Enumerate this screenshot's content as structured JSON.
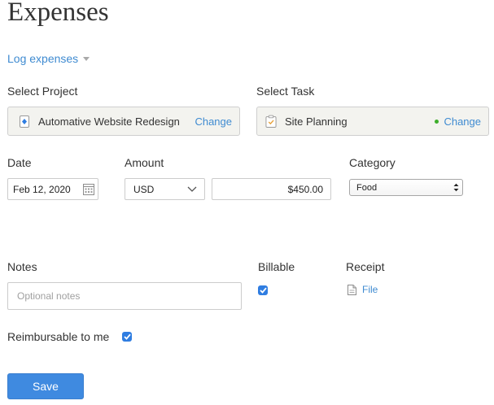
{
  "page": {
    "title": "Expenses"
  },
  "log_menu": {
    "label": "Log expenses"
  },
  "project": {
    "label": "Select Project",
    "selected": "Automative Website Redesign",
    "change_label": "Change"
  },
  "task": {
    "label": "Select Task",
    "selected": "Site Planning",
    "change_label": "Change",
    "status_color": "#3dae2b"
  },
  "date": {
    "label": "Date",
    "value": "Feb 12, 2020",
    "icon": "calendar-icon"
  },
  "amount": {
    "label": "Amount",
    "currency": "USD",
    "value": "$450.00"
  },
  "category": {
    "label": "Category",
    "value": "Food"
  },
  "notes": {
    "label": "Notes",
    "placeholder": "Optional notes",
    "value": ""
  },
  "billable": {
    "label": "Billable",
    "checked": true
  },
  "receipt": {
    "label": "Receipt",
    "file_label": "File",
    "icon": "document-icon"
  },
  "reimbursable": {
    "label": "Reimbursable to me",
    "checked": true
  },
  "save": {
    "label": "Save"
  },
  "colors": {
    "link": "#3f8bd1",
    "primary_button": "#3f8ae0",
    "checkbox": "#2f7de1",
    "picker_bg": "#f3f3ef"
  }
}
